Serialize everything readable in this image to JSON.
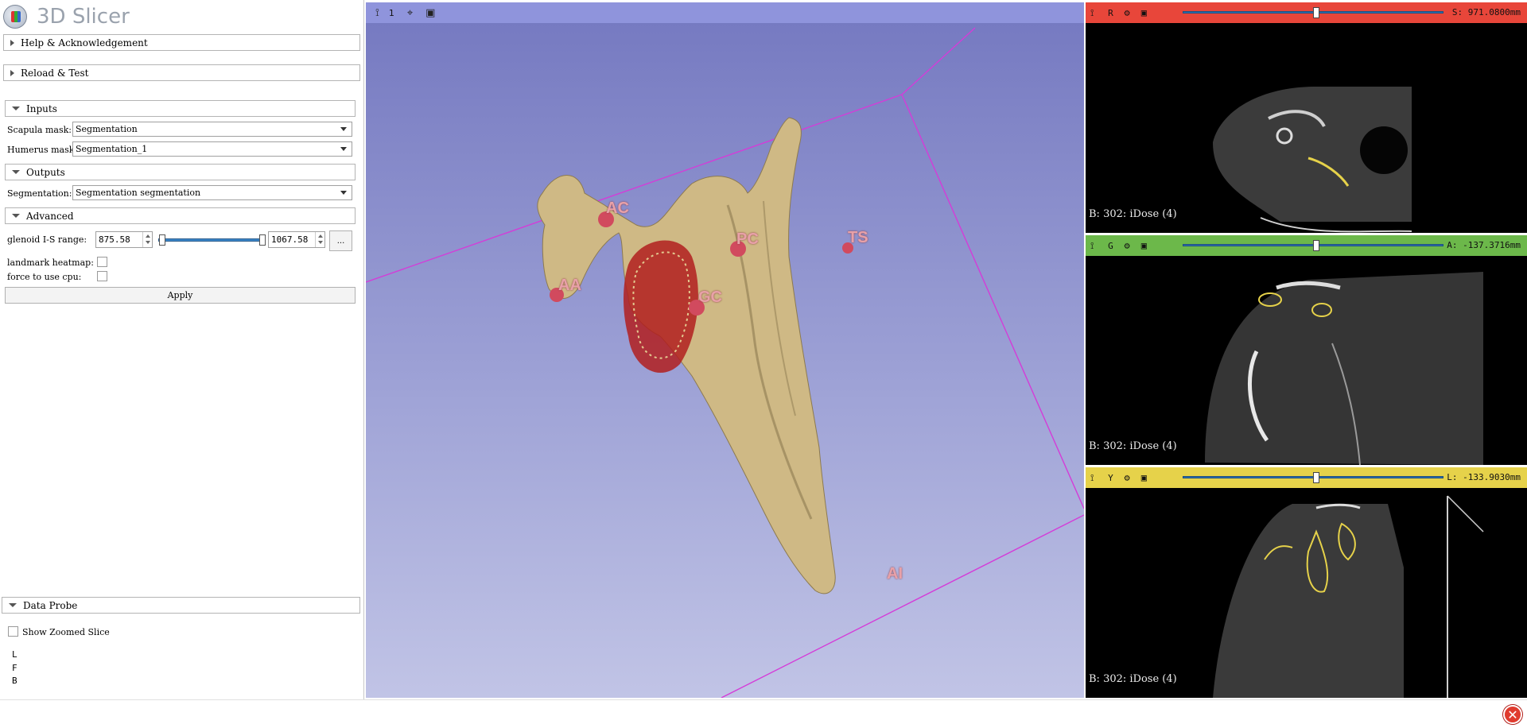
{
  "app": {
    "title": "3D Slicer"
  },
  "sections": {
    "help": "Help & Acknowledgement",
    "reload": "Reload & Test",
    "inputs": "Inputs",
    "outputs": "Outputs",
    "advanced": "Advanced",
    "data_probe": "Data Probe"
  },
  "inputs": {
    "scapula_label": "Scapula mask:",
    "scapula_value": "Segmentation",
    "humerus_label": "Humerus mask:",
    "humerus_value": "Segmentation_1"
  },
  "outputs": {
    "segmentation_label": "Segmentation:",
    "segmentation_value": "Segmentation segmentation"
  },
  "advanced": {
    "range_label": "glenoid I-S range:",
    "range_min": "875.58",
    "range_max": "1067.58",
    "range_min_fraction": 0.0,
    "range_max_fraction": 1.0,
    "more_button": "...",
    "heatmap_label": "landmark heatmap:",
    "cpu_label": "force to use cpu:",
    "apply_label": "Apply"
  },
  "data_probe": {
    "show_zoomed_label": "Show Zoomed Slice",
    "L": "L",
    "F": "F",
    "B": "B"
  },
  "view3d": {
    "view_number": "1",
    "accent": "#8f94dc",
    "landmarks": [
      "AC",
      "PC",
      "TS",
      "AA",
      "GC",
      "AI"
    ]
  },
  "slices": {
    "red": {
      "label": "R",
      "offset": "S: 971.0800mm",
      "series": "B: 302: iDose (4)",
      "color": "#e8463a",
      "position_fraction": 0.51
    },
    "green": {
      "label": "G",
      "offset": "A: -137.3716mm",
      "series": "B: 302: iDose (4)",
      "color": "#6cb84a",
      "position_fraction": 0.51
    },
    "yellow": {
      "label": "Y",
      "offset": "L: -133.9030mm",
      "series": "B: 302: iDose (4)",
      "color": "#e6d24a",
      "position_fraction": 0.51
    }
  },
  "icons": {
    "pin": "pin-icon",
    "link": "link-icon",
    "maximize": "maximize-icon",
    "center": "center-view-icon",
    "close": "close-icon"
  }
}
